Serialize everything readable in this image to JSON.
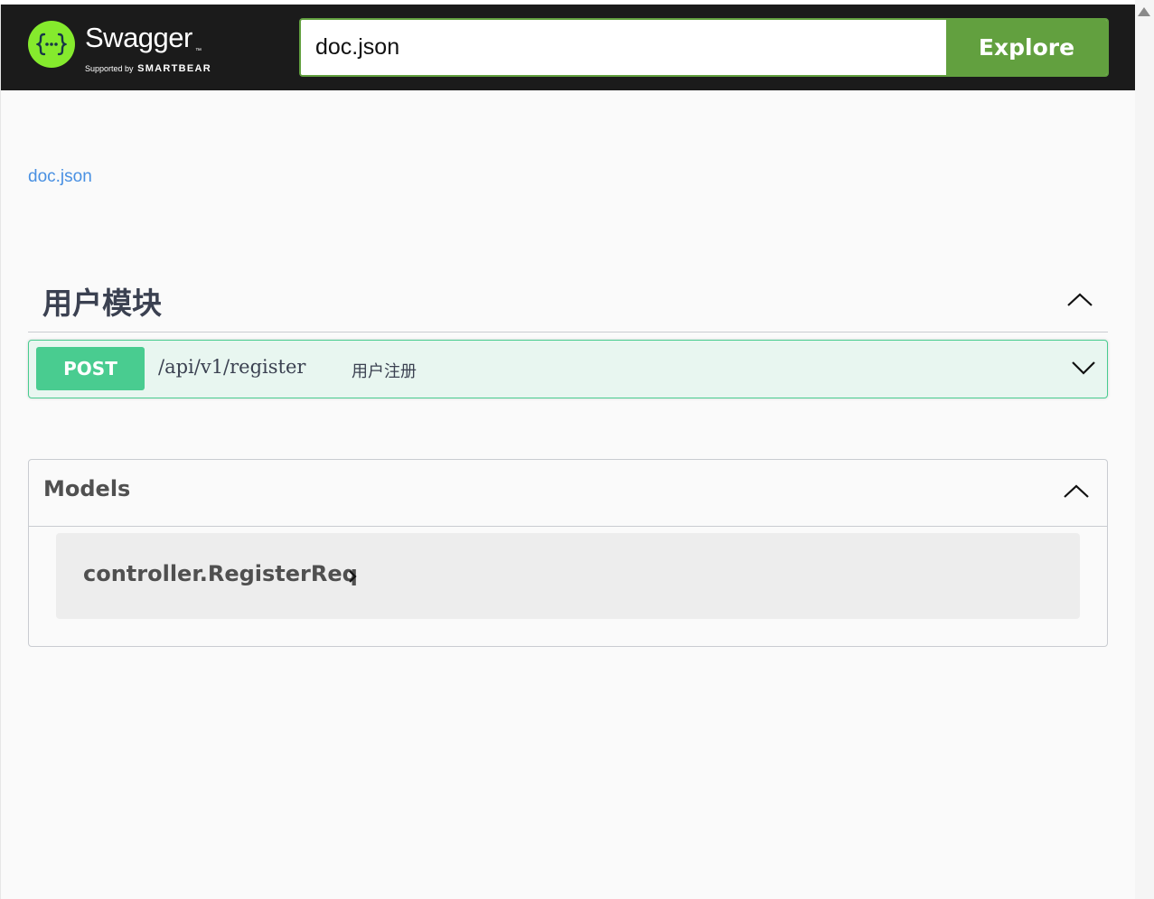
{
  "header": {
    "logo": {
      "name": "Swagger",
      "trademark": "™",
      "supported_by": "Supported by",
      "company": "SMARTBEAR"
    },
    "url_input": {
      "value": "doc.json"
    },
    "explore_label": "Explore"
  },
  "info": {
    "spec_link": "doc.json"
  },
  "tags": [
    {
      "name": "用户模块",
      "operations": [
        {
          "method": "POST",
          "path": "/api/v1/register",
          "summary": "用户注册"
        }
      ]
    }
  ],
  "models": {
    "title": "Models",
    "items": [
      {
        "name": "controller.RegisterReq"
      }
    ]
  },
  "colors": {
    "topbar": "#1b1b1b",
    "brand_green": "#85ea2d",
    "explore": "#62a03f",
    "post": "#49cc90",
    "post_bg": "#e8f6f0",
    "link": "#4990e2"
  },
  "icons": {
    "logo": "swagger-braces-icon",
    "tag_toggle": "chevron-up-icon",
    "op_toggle": "chevron-down-icon",
    "models_toggle": "chevron-up-icon",
    "model_expand": "chevron-right-icon",
    "scroll_up": "arrow-up-icon"
  }
}
